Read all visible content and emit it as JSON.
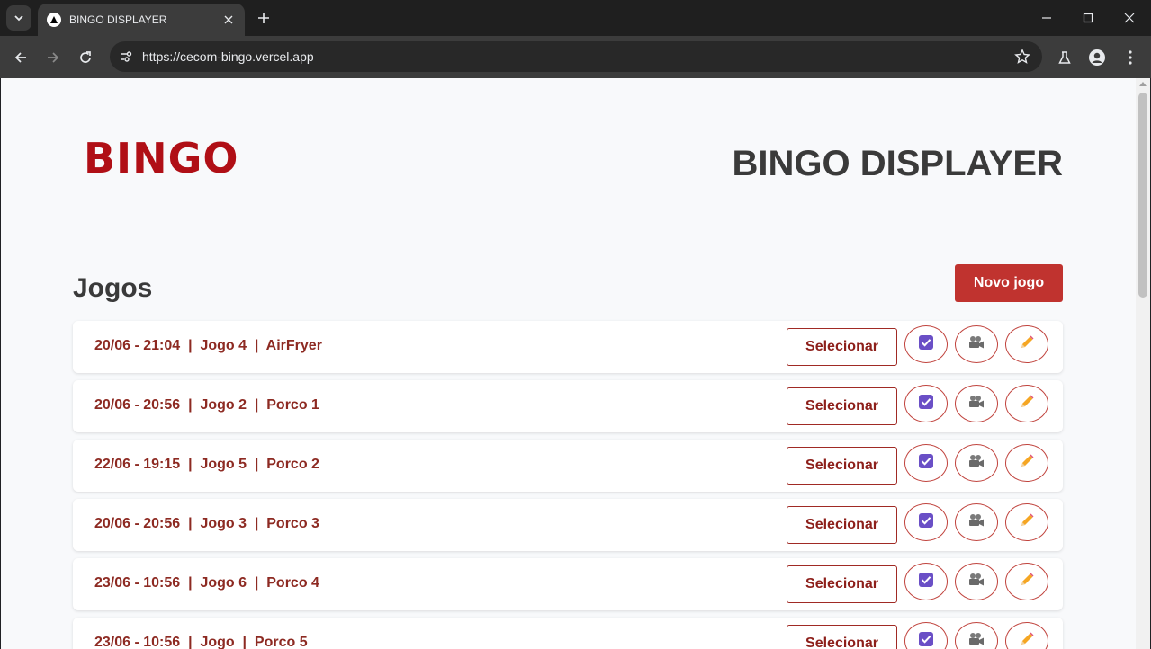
{
  "browser": {
    "tab_title": "BINGO DISPLAYER",
    "url": "https://cecom-bingo.vercel.app",
    "icons": [
      "tab-search-icon",
      "favicon",
      "close-icon",
      "new-tab-icon",
      "minimize-icon",
      "maximize-icon",
      "close-window-icon",
      "back-icon",
      "forward-icon",
      "reload-icon",
      "site-info-icon",
      "bookmark-star-icon",
      "labs-icon",
      "profile-icon",
      "menu-icon"
    ]
  },
  "header": {
    "logo_text": "BINGO",
    "title": "BINGO DISPLAYER"
  },
  "games_section": {
    "title": "Jogos",
    "new_button_label": "Novo jogo",
    "select_label": "Selecionar",
    "items": [
      {
        "label": "20/06 - 21:04  |  Jogo 4  |  AirFryer"
      },
      {
        "label": "20/06 - 20:56  |  Jogo 2  |  Porco 1"
      },
      {
        "label": "22/06 - 19:15  |  Jogo 5  |  Porco 2"
      },
      {
        "label": "20/06 - 20:56  |  Jogo 3  |  Porco 3"
      },
      {
        "label": "23/06 - 10:56  |  Jogo 6  |  Porco 4"
      },
      {
        "label": "23/06 - 10:56  |  Jogo  |  Porco 5"
      }
    ]
  },
  "colors": {
    "brand_red": "#b00f16",
    "button_red": "#c0332f",
    "text_dark_red": "#8d2a22",
    "check_purple": "#6a4fc6",
    "pencil_orange": "#f5a623"
  }
}
